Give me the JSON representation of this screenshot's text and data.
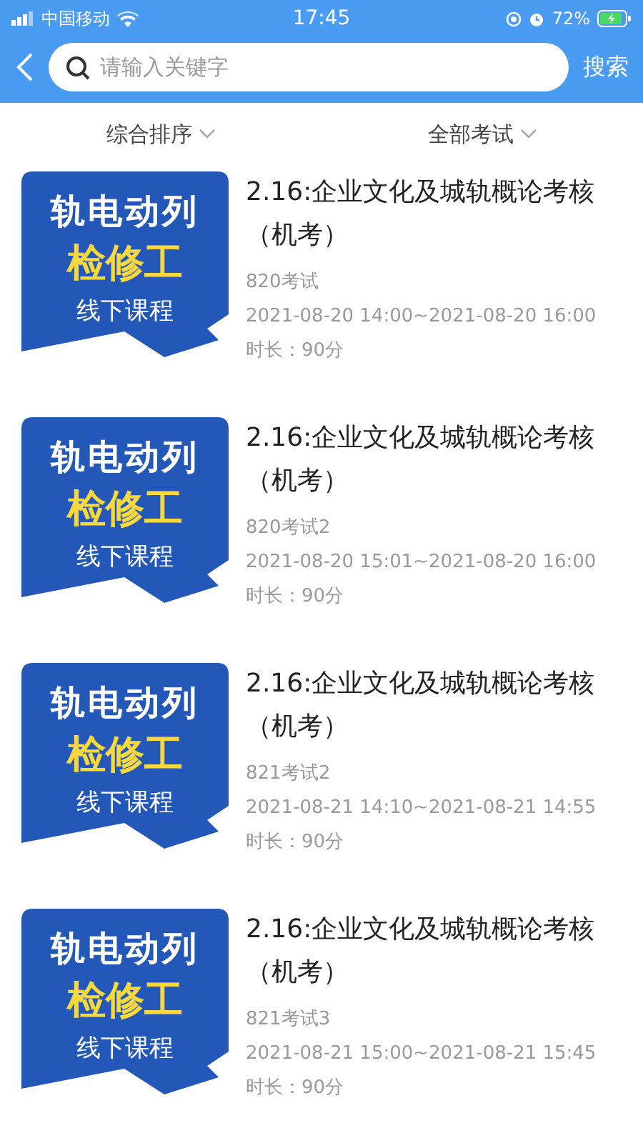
{
  "status_bar": {
    "carrier": "中国移动",
    "time": "17:45",
    "battery": "72%"
  },
  "header": {
    "search": {
      "placeholder": "请输入关键字"
    },
    "search_button": "搜索"
  },
  "filters": [
    {
      "label": "综合排序"
    },
    {
      "label": "全部考试"
    }
  ],
  "exams": [
    {
      "cover": {
        "line_1": "轨电动列",
        "line_2": "检修工",
        "line_3": "线下课程"
      },
      "title": "2.16:企业文化及城轨概论考核（机考）",
      "name": "820考试",
      "period": "2021-08-20 14:00~2021-08-20 16:00",
      "duration": "时长：90分"
    },
    {
      "cover": {
        "line_1": "轨电动列",
        "line_2": "检修工",
        "line_3": "线下课程"
      },
      "title": "2.16:企业文化及城轨概论考核（机考）",
      "name": "820考试2",
      "period": "2021-08-20 15:01~2021-08-20 16:00",
      "duration": "时长：90分"
    },
    {
      "cover": {
        "line_1": "轨电动列",
        "line_2": "检修工",
        "line_3": "线下课程"
      },
      "title": "2.16:企业文化及城轨概论考核（机考）",
      "name": "821考试2",
      "period": "2021-08-21 14:10~2021-08-21 14:55",
      "duration": "时长：90分"
    },
    {
      "cover": {
        "line_1": "轨电动列",
        "line_2": "检修工",
        "line_3": "线下课程"
      },
      "title": "2.16:企业文化及城轨概论考核（机考）",
      "name": "821考试3",
      "period": "2021-08-21 15:00~2021-08-21 15:45",
      "duration": "时长：90分"
    }
  ]
}
